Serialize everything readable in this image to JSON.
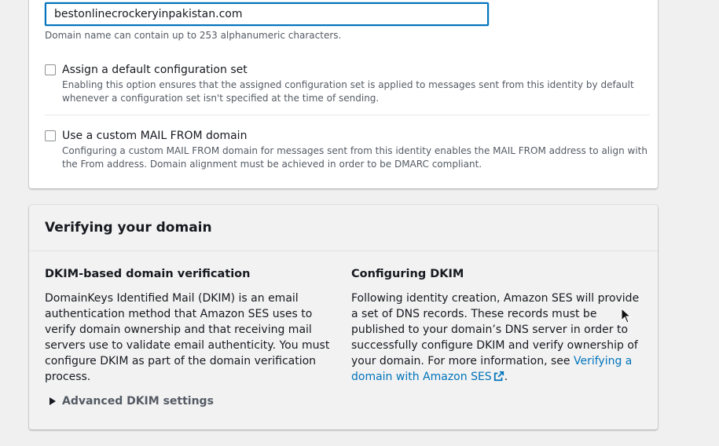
{
  "domain_input": {
    "value": "bestonlinecrockeryinpakistan.com",
    "hint": "Domain name can contain up to 253 alphanumeric characters."
  },
  "options": [
    {
      "label": "Assign a default configuration set",
      "description": "Enabling this option ensures that the assigned configuration set is applied to messages sent from this identity by default whenever a configuration set isn't specified at the time of sending.",
      "checked": false
    },
    {
      "label": "Use a custom MAIL FROM domain",
      "description": "Configuring a custom MAIL FROM domain for messages sent from this identity enables the MAIL FROM address to align with the From address. Domain alignment must be achieved in order to be DMARC compliant.",
      "checked": false
    }
  ],
  "verify_section": {
    "title": "Verifying your domain",
    "left": {
      "title": "DKIM-based domain verification",
      "text": "DomainKeys Identified Mail (DKIM) is an email authentication method that Amazon SES uses to verify domain ownership and that receiving mail servers use to validate email authenticity. You must configure DKIM as part of the domain verification process."
    },
    "right": {
      "title": "Configuring DKIM",
      "text_before_link": "Following identity creation, Amazon SES will provide a set of DNS records. These records must be published to your domain’s DNS server in order to successfully configure DKIM and verify ownership of your domain. For more information, see ",
      "link": "Verifying a domain with Amazon SES",
      "text_after_link": "."
    },
    "advanced_toggle": "Advanced DKIM settings"
  },
  "colors": {
    "accent": "#0073bb",
    "text": "#16191f",
    "secondary_text": "#545b64"
  }
}
